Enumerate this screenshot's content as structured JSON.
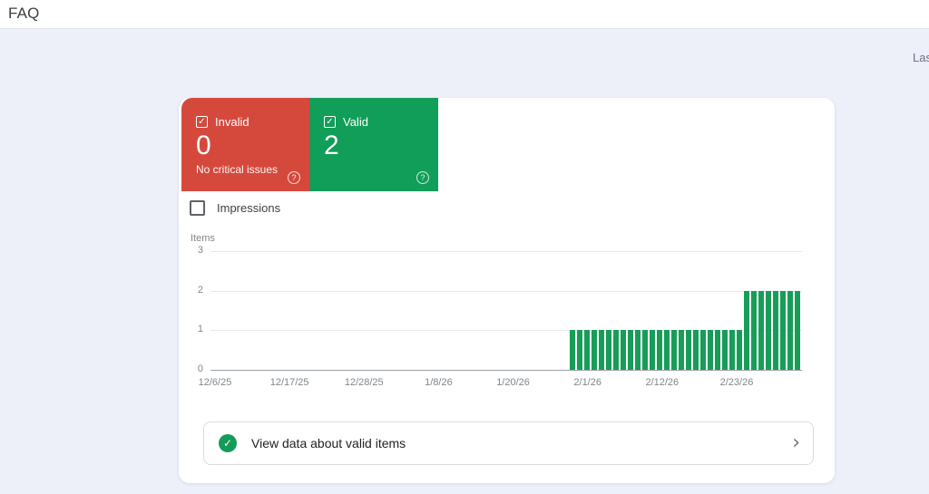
{
  "header": {
    "title": "FAQ"
  },
  "meta": {
    "last_updated_fragment": "Las"
  },
  "cards": {
    "invalid": {
      "label": "Invalid",
      "count": "0",
      "note": "No critical issues",
      "color": "#d5493d",
      "help": "?",
      "checked": true
    },
    "valid": {
      "label": "Valid",
      "count": "2",
      "color": "#119e58",
      "help": "?",
      "checked": true
    }
  },
  "impressions_toggle": {
    "label": "Impressions",
    "checked": false
  },
  "chart_data": {
    "type": "bar",
    "title": "",
    "ylabel": "Items",
    "ylim": [
      0,
      3
    ],
    "y_ticks": [
      3,
      2,
      1,
      0
    ],
    "grid": true,
    "legend_position": "none",
    "x_tick_labels": [
      "12/6/25",
      "12/17/25",
      "12/28/25",
      "1/8/26",
      "1/20/26",
      "2/1/26",
      "2/12/26",
      "2/23/26"
    ],
    "series": [
      {
        "name": "Valid items",
        "color": "#189d58",
        "dates": [
          "1/31/26",
          "2/1/26",
          "2/2/26",
          "2/3/26",
          "2/4/26",
          "2/5/26",
          "2/6/26",
          "2/7/26",
          "2/8/26",
          "2/9/26",
          "2/10/26",
          "2/11/26",
          "2/12/26",
          "2/13/26",
          "2/14/26",
          "2/15/26",
          "2/16/26",
          "2/17/26",
          "2/18/26",
          "2/19/26",
          "2/20/26",
          "2/21/26",
          "2/22/26",
          "2/23/26",
          "2/24/26",
          "2/25/26",
          "2/26/26",
          "2/27/26",
          "2/28/26",
          "3/1/26",
          "3/2/26",
          "3/3/26"
        ],
        "values": [
          1,
          1,
          1,
          1,
          1,
          1,
          1,
          1,
          1,
          1,
          1,
          1,
          1,
          1,
          1,
          1,
          1,
          1,
          1,
          1,
          1,
          1,
          1,
          1,
          2,
          2,
          2,
          2,
          2,
          2,
          2,
          2
        ]
      }
    ]
  },
  "footer_row": {
    "label": "View data about valid items",
    "icon_color": "#149c57",
    "chevron": "›"
  }
}
